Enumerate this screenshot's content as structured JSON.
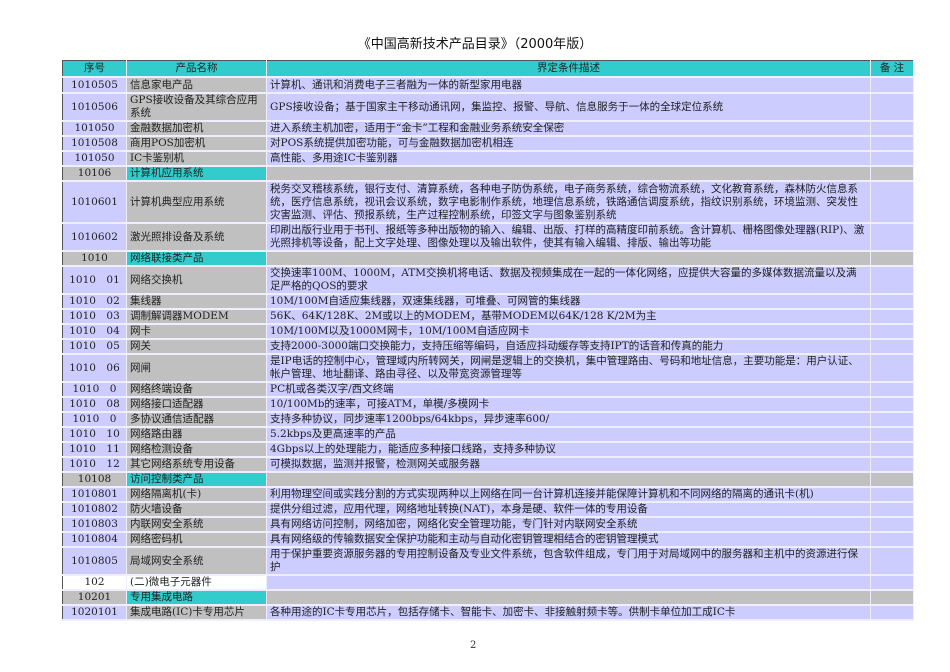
{
  "title": "《中国高新技术产品目录》（2000年版）",
  "page_number": "2",
  "colors": {
    "header": "#33cccc",
    "lavender": "#ccccff",
    "gray": "#c0c0c0",
    "section_name": "#33cccc"
  },
  "headers": {
    "code": "序号",
    "name": "产品名称",
    "desc": "界定条件描述",
    "note": "备 注"
  },
  "rows": [
    {
      "type": "item",
      "code": "1010505",
      "name": "信息家电产品",
      "desc": "计算机、通讯和消费电子三者融为一体的新型家用电器"
    },
    {
      "type": "item",
      "code": "1010506",
      "name": "GPS接收设备及其综合应用系统",
      "desc": "GPS接收设备；基于国家主干移动通讯网，集监控、报警、导航、信息服务于一体的全球定位系统"
    },
    {
      "type": "item",
      "code": "101050",
      "name": "金融数据加密机",
      "desc": "进入系统主机加密，适用于“金卡”工程和金融业务系统安全保密"
    },
    {
      "type": "item",
      "code": "1010508",
      "name": "商用POS加密机",
      "desc": "对POS系统提供加密功能，可与金融数据加密机相连"
    },
    {
      "type": "item",
      "code": "101050",
      "name": "IC卡鉴别机",
      "desc": "高性能、多用途IC卡鉴别器"
    },
    {
      "type": "section",
      "code": "10106",
      "name": "计算机应用系统",
      "desc": ""
    },
    {
      "type": "item",
      "code": "1010601",
      "name": "计算机典型应用系统",
      "desc": "税务交叉稽核系统，银行支付、清算系统，各种电子防伪系统，电子商务系统，综合物流系统，文化教育系统，森林防火信息系统，医疗信息系统，视讯会议系统，数字电影制作系统，地理信息系统，铁路通信调度系统，指纹识别系统，环境监测、突发性灾害监测、评估、预报系统，生产过程控制系统，印签文字与图象鉴别系统"
    },
    {
      "type": "item",
      "code": "1010602",
      "name": "激光照排设备及系统",
      "desc": "印刷出版行业用于书刊、报纸等多种出版物的输入、编辑、出版、打样的高精度印前系统。含计算机、栅格图像处理器(RIP)、激光照排机等设备，配上文字处理、图像处理以及输出软件，使其有输入编辑、排版、输出等功能"
    },
    {
      "type": "section",
      "code": "1010",
      "name": "网络联接类产品",
      "desc": ""
    },
    {
      "type": "item",
      "code": "1010　01",
      "name": "网络交换机",
      "desc": "交换速率100M、1000M，ATM交换机将电话、数据及视频集成在一起的一体化网络，应提供大容量的多媒体数据流量以及满足严格的QOS的要求"
    },
    {
      "type": "item",
      "code": "1010　02",
      "name": "集线器",
      "desc": "10M/100M自适应集线器，双速集线器，可堆叠、可网管的集线器"
    },
    {
      "type": "item",
      "code": "1010　03",
      "name": "调制解调器MODEM",
      "desc": "56K、64K/128K、2M或以上的MODEM，基带MODEM以64K/128 K/2M为主"
    },
    {
      "type": "item",
      "code": "1010　04",
      "name": "网卡",
      "desc": "10M/100M以及1000M网卡，10M/100M自适应网卡"
    },
    {
      "type": "item",
      "code": "1010　05",
      "name": "网关",
      "desc": "支持2000-3000端口交换能力，支持压缩等编码，自适应抖动缓存等支持IPT的话音和传真的能力"
    },
    {
      "type": "item",
      "code": "1010　06",
      "name": "网闸",
      "desc": "是IP电话的控制中心，管理域内所转网关，网闸是逻辑上的交换机，集中管理路由、号码和地址信息，主要功能是：用户认证、帐户管理、地址翻译、路由寻径、以及带宽资源管理等"
    },
    {
      "type": "item",
      "code": "1010　0",
      "name": "网络终端设备",
      "desc": "PC机或各类汉字/西文终端"
    },
    {
      "type": "item",
      "code": "1010　08",
      "name": "网络接口适配器",
      "desc": "10/100Mb的速率，可接ATM，单模/多模网卡"
    },
    {
      "type": "item",
      "code": "1010　0",
      "name": "多协议通信适配器",
      "desc": "支持多种协议，同步速率1200bps/64kbps，异步速率600/"
    },
    {
      "type": "item",
      "code": "1010　10",
      "name": "网络路由器",
      "desc": "5.2kbps及更高速率的产品"
    },
    {
      "type": "item",
      "code": "1010　11",
      "name": "网络检测设备",
      "desc": "4Gbps以上的处理能力，能适应多种接口线路，支持多种协议"
    },
    {
      "type": "item",
      "code": "1010　12",
      "name": "其它网络系统专用设备",
      "desc": "可模拟数据，监测并报警，检测网关或服务器"
    },
    {
      "type": "section",
      "code": "10108",
      "name": "访问控制类产品",
      "desc": ""
    },
    {
      "type": "item",
      "code": "1010801",
      "name": "网络隔离机(卡)",
      "desc": "利用物理空间或实践分割的方式实现两种以上网络在同一台计算机连接并能保障计算机和不同网络的隔离的通讯卡(机)"
    },
    {
      "type": "item",
      "code": "1010802",
      "name": "防火墙设备",
      "desc": "提供分组过滤，应用代理，网络地址转换(NAT)，本身是硬、软件一体的专用设备"
    },
    {
      "type": "item",
      "code": "1010803",
      "name": "内联网安全系统",
      "desc": "具有网络访问控制，网络加密，网络化安全管理功能，专门针对内联网安全系统"
    },
    {
      "type": "item",
      "code": "1010804",
      "name": "网络密码机",
      "desc": "具有网络级的传输数据安全保护功能和主动与自动化密钥管理相结合的密钥管理模式"
    },
    {
      "type": "item",
      "code": "1010805",
      "name": "局域网安全系统",
      "desc": "用于保护重要资源服务器的专用控制设备及专业文件系统，包含软件组成，专门用于对局域网中的服务器和主机中的资源进行保护"
    },
    {
      "type": "category",
      "code": "102",
      "name": "(二)微电子元器件",
      "desc": ""
    },
    {
      "type": "section",
      "code": "10201",
      "name": "专用集成电路",
      "desc": ""
    },
    {
      "type": "item",
      "code": "1020101",
      "name": "集成电路(IC)卡专用芯片",
      "desc": "各种用途的IC卡专用芯片，包括存储卡、智能卡、加密卡、非接触射频卡等。供制卡单位加工成IC卡"
    }
  ]
}
